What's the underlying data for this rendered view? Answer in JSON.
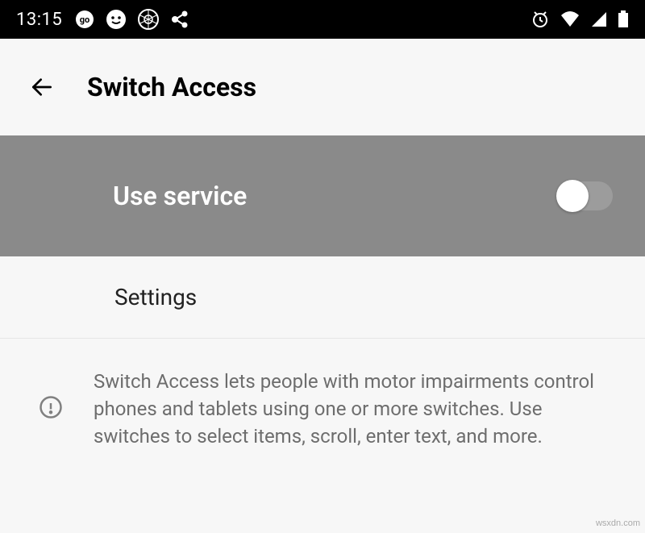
{
  "status": {
    "time": "13:15"
  },
  "header": {
    "title": "Switch Access"
  },
  "service": {
    "label": "Use service",
    "enabled": false
  },
  "settings": {
    "label": "Settings"
  },
  "info": {
    "text": "Switch Access lets people with motor impairments control phones and tablets using one or more switches. Use switches to select items, scroll, enter text, and more."
  },
  "watermark": "wsxdn.com"
}
